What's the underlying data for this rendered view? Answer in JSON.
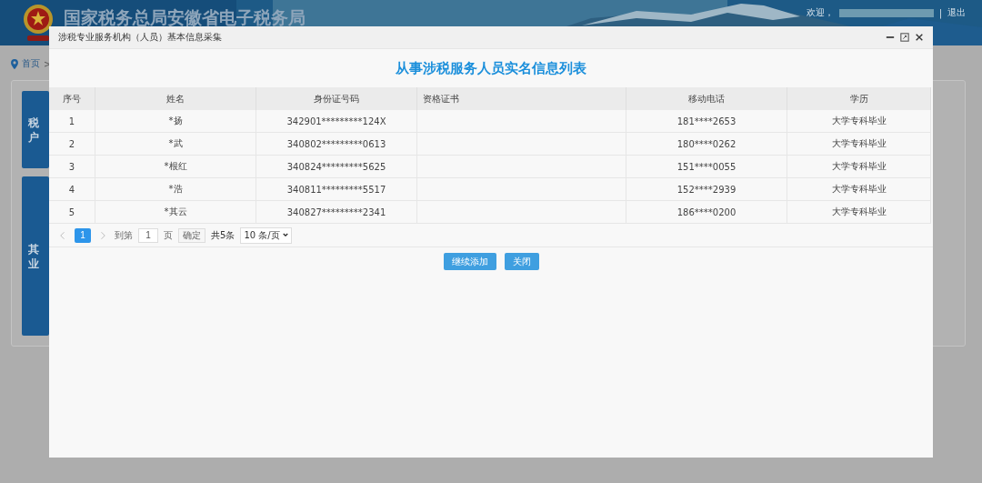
{
  "header": {
    "site_title": "国家税务总局安徽省电子税务局",
    "welcome": "欢迎，",
    "separator": "|",
    "logout": "退出"
  },
  "breadcrumb": {
    "home": "首页",
    "arrow": ">"
  },
  "cards": [
    {
      "lines": [
        "税",
        "户"
      ]
    },
    {
      "lines": [
        "其",
        "业"
      ]
    }
  ],
  "dialog": {
    "title": "涉税专业服务机构（人员）基本信息采集",
    "heading": "从事涉税服务人员实名信息列表",
    "table": {
      "columns": [
        "序号",
        "姓名",
        "身份证号码",
        "资格证书",
        "移动电话",
        "学历"
      ],
      "rows": [
        [
          "1",
          "*扬",
          "342901*********124X",
          "",
          "181****2653",
          "大学专科毕业"
        ],
        [
          "2",
          "*武",
          "340802*********0613",
          "",
          "180****0262",
          "大学专科毕业"
        ],
        [
          "3",
          "*根红",
          "340824*********5625",
          "",
          "151****0055",
          "大学专科毕业"
        ],
        [
          "4",
          "*浩",
          "340811*********5517",
          "",
          "152****2939",
          "大学专科毕业"
        ],
        [
          "5",
          "*其云",
          "340827*********2341",
          "",
          "186****0200",
          "大学专科毕业"
        ]
      ]
    },
    "pagination": {
      "pages": [
        {
          "label": "1",
          "selected": true
        }
      ],
      "goto_label": "到第",
      "goto_value": "1",
      "page_unit": "页",
      "confirm": "确定",
      "total": "共5条",
      "page_size": "10 条/页"
    },
    "buttons": [
      "继续添加",
      "关闭"
    ]
  }
}
